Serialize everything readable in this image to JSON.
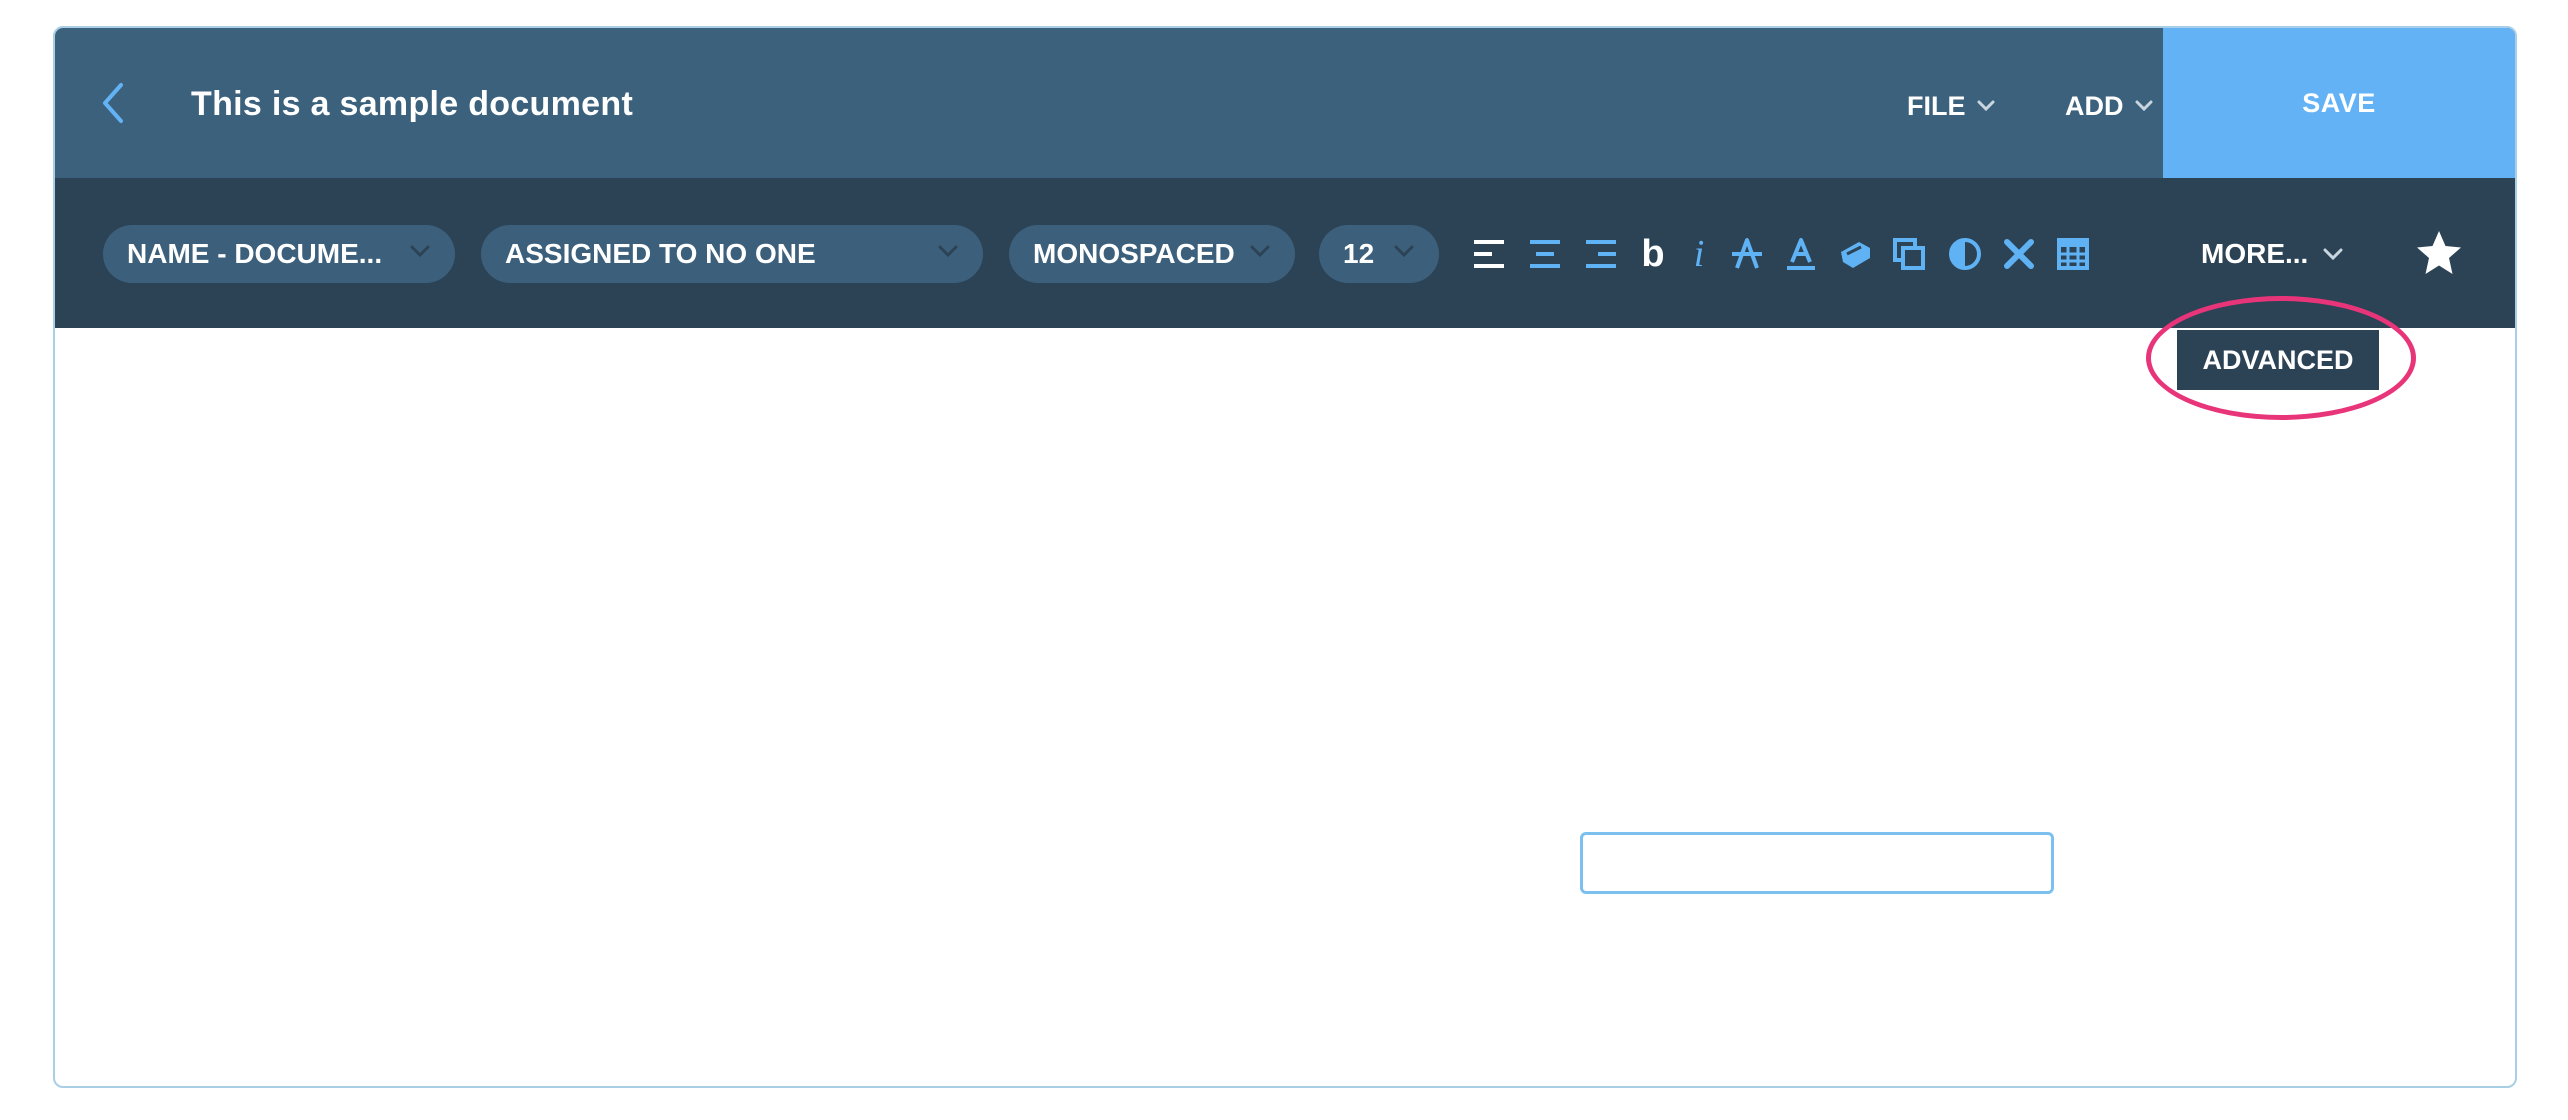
{
  "header": {
    "back_icon": "chevron-left-icon",
    "title": "This is a sample document",
    "menus": [
      {
        "label": "FILE",
        "icon": "chevron-down-icon"
      },
      {
        "label": "ADD",
        "icon": "chevron-down-icon"
      }
    ],
    "save_label": "SAVE"
  },
  "toolbar": {
    "name_select": "NAME - DOCUME...",
    "assignee_select": "ASSIGNED TO NO ONE",
    "font_select": "MONOSPACED",
    "size_select": "12",
    "format_icons": [
      "align-left-icon",
      "align-center-icon",
      "align-right-icon",
      "bold-icon",
      "italic-icon",
      "strikethrough-icon",
      "text-color-icon",
      "highlighter-icon",
      "copy-icon",
      "contrast-icon",
      "clear-format-icon",
      "table-icon"
    ],
    "bold_glyph": "b",
    "italic_glyph": "i",
    "more_label": "MORE...",
    "star_icon": "star-icon"
  },
  "dropdown": {
    "advanced_label": "ADVANCED"
  },
  "editor": {
    "input_value": ""
  },
  "colors": {
    "header_bg": "#3c617d",
    "toolbar_bg": "#2c4255",
    "pill_bg": "#3c607c",
    "save_bg": "#62b2f5",
    "accent_icon": "#5fb3f5",
    "highlight_ring": "#e8357a"
  }
}
